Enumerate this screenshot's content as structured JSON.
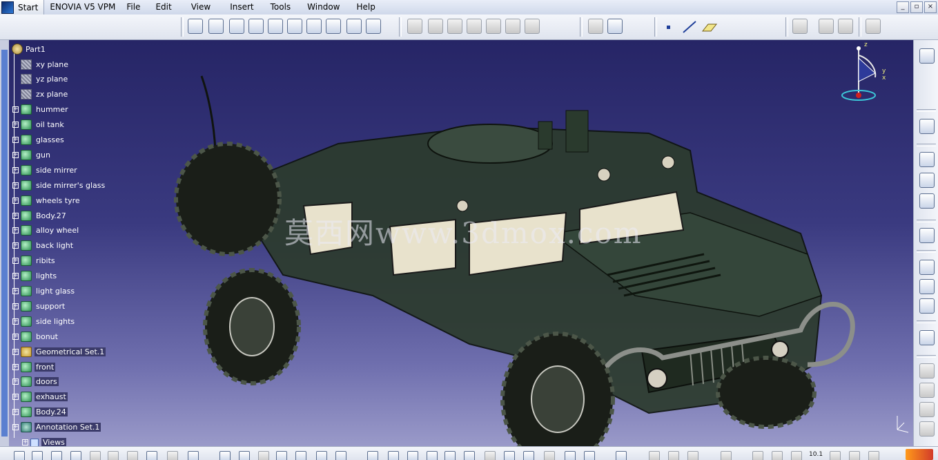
{
  "menubar": {
    "start_label": "Start",
    "brand_label": "ENOVIA V5 VPM",
    "items": [
      "File",
      "Edit",
      "View",
      "Insert",
      "Tools",
      "Window",
      "Help"
    ]
  },
  "toolbar": {
    "icons": [
      "part-design-icon",
      "sketch-icon",
      "pad-icon",
      "pocket-icon",
      "shaft-icon",
      "groove-icon",
      "hole-icon",
      "rib-icon",
      "slot-icon",
      "stiffener-icon",
      "multi-section-icon",
      "removed-multi-section-icon",
      "fillet-icon",
      "chamfer-icon",
      "draft-icon",
      "shell-icon",
      "thickness-icon",
      "thread-icon",
      "remove-face-icon",
      "replace-face-icon",
      "point-icon",
      "line-icon",
      "plane-icon",
      "boolean-icon",
      "pattern-icon",
      "mirror-icon",
      "measure-icon"
    ]
  },
  "tree": {
    "root": "Part1",
    "nodes": [
      {
        "label": "xy plane",
        "icon": "plane-icon",
        "expandable": false
      },
      {
        "label": "yz plane",
        "icon": "plane-icon",
        "expandable": false
      },
      {
        "label": "zx plane",
        "icon": "plane-icon",
        "expandable": false
      },
      {
        "label": "hummer",
        "icon": "body-icon",
        "expandable": true
      },
      {
        "label": "oil tank",
        "icon": "body-icon",
        "expandable": true
      },
      {
        "label": "glasses",
        "icon": "body-icon",
        "expandable": true
      },
      {
        "label": "gun",
        "icon": "body-icon",
        "expandable": true
      },
      {
        "label": "side mirrer",
        "icon": "body-icon",
        "expandable": true
      },
      {
        "label": "side mirrer's glass",
        "icon": "body-icon",
        "expandable": true
      },
      {
        "label": "wheels tyre",
        "icon": "body-icon",
        "expandable": true
      },
      {
        "label": "Body.27",
        "icon": "body-icon",
        "expandable": true
      },
      {
        "label": "alloy wheel",
        "icon": "body-icon",
        "expandable": true
      },
      {
        "label": "back light",
        "icon": "body-icon",
        "expandable": true
      },
      {
        "label": "ribits",
        "icon": "body-icon",
        "expandable": true
      },
      {
        "label": "lights",
        "icon": "body-icon",
        "expandable": true
      },
      {
        "label": "light glass",
        "icon": "body-icon",
        "expandable": true
      },
      {
        "label": "support",
        "icon": "body-icon",
        "expandable": true
      },
      {
        "label": "side lights",
        "icon": "body-icon",
        "expandable": true
      },
      {
        "label": "bonut",
        "icon": "body-icon",
        "expandable": true
      },
      {
        "label": "Geometrical Set.1",
        "icon": "geometrical-set-icon",
        "expandable": true,
        "highlight": true
      },
      {
        "label": "front",
        "icon": "body-icon",
        "expandable": true,
        "highlight": true
      },
      {
        "label": "doors",
        "icon": "body-icon",
        "expandable": true,
        "highlight": true
      },
      {
        "label": "exhaust",
        "icon": "body-icon",
        "expandable": true,
        "highlight": true
      },
      {
        "label": "Body.24",
        "icon": "body-icon",
        "expandable": true,
        "highlight": true
      },
      {
        "label": "Annotation Set.1",
        "icon": "annotation-set-icon",
        "expandable": true,
        "highlight": true
      },
      {
        "label": "Views",
        "icon": "views-icon",
        "expandable": true,
        "highlight": true,
        "indent": true
      }
    ]
  },
  "viewport": {
    "watermark": "莫西网www.3dmox.com",
    "compass": {
      "z": "z",
      "y": "y",
      "x": "x"
    }
  },
  "bottombar": {
    "scale_label": "10.1"
  }
}
